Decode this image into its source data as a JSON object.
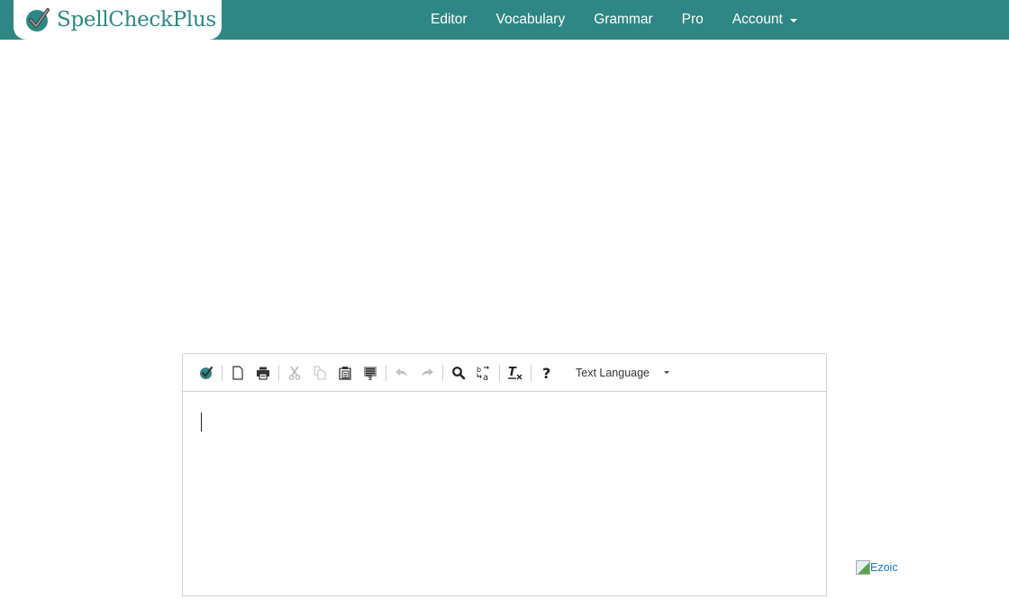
{
  "navbar": {
    "brand": "SpellCheckPlus",
    "links": [
      {
        "label": "Editor"
      },
      {
        "label": "Vocabulary"
      },
      {
        "label": "Grammar"
      },
      {
        "label": "Pro"
      },
      {
        "label": "Account",
        "dropdown": true
      }
    ],
    "color": "#2e8784"
  },
  "editor": {
    "toolbar": {
      "buttons": [
        {
          "icon": "spellcheck-icon",
          "title": "Check"
        },
        {
          "icon": "new-document-icon",
          "title": "New"
        },
        {
          "icon": "print-icon",
          "title": "Print"
        },
        {
          "icon": "cut-icon",
          "title": "Cut",
          "disabled": true
        },
        {
          "icon": "copy-icon",
          "title": "Copy",
          "disabled": true
        },
        {
          "icon": "paste-icon",
          "title": "Paste"
        },
        {
          "icon": "paste-plain-text-icon",
          "title": "Paste as plain text"
        },
        {
          "icon": "undo-icon",
          "title": "Undo",
          "disabled": true
        },
        {
          "icon": "redo-icon",
          "title": "Redo",
          "disabled": true
        },
        {
          "icon": "find-icon",
          "title": "Find"
        },
        {
          "icon": "replace-icon",
          "title": "Replace"
        },
        {
          "icon": "remove-format-icon",
          "title": "Remove Format"
        },
        {
          "icon": "help-icon",
          "title": "Help"
        }
      ],
      "language_select": "Text Language"
    },
    "content": ""
  },
  "ad": {
    "label": "Ezoic"
  }
}
